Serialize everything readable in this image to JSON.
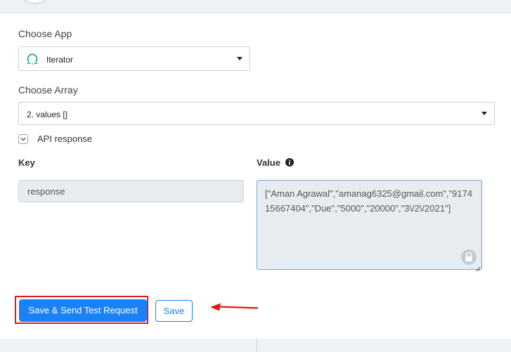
{
  "form": {
    "choose_app_label": "Choose App",
    "app_value": "Iterator",
    "choose_array_label": "Choose Array",
    "array_value": "2. values []",
    "api_response_label": "API response",
    "key_header": "Key",
    "value_header": "Value",
    "key_value": "response",
    "value_value": "[\"Aman Agrawal\",\"amanag6325@gmail.com\",\"917415667404\",\"Due\",\"5000\",\"20000\",\"3\\/2\\/2021\"]"
  },
  "actions": {
    "save_send_label": "Save & Send Test Request",
    "save_label": "Save"
  },
  "colors": {
    "primary": "#1a82f7",
    "highlight": "#e01b1b",
    "iterator_icon": "#16a085"
  },
  "icons": {
    "app": "iterator-icon",
    "info": "info-icon",
    "lock": "lock-icon",
    "annotation": "arrow-left-icon"
  }
}
